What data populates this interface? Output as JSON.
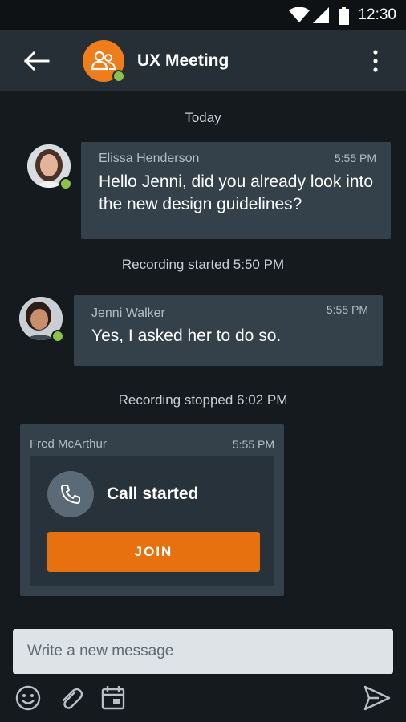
{
  "status_bar": {
    "time": "12:30"
  },
  "header": {
    "title": "UX Meeting"
  },
  "conversation": {
    "date_separator": "Today",
    "messages": [
      {
        "sender": "Elissa Henderson",
        "time": "5:55 PM",
        "text": "Hello Jenni, did you already look into the new design guidelines?"
      },
      {
        "sender": "Jenni Walker",
        "time": "5:55 PM",
        "text": "Yes, I asked her to do so."
      }
    ],
    "system_messages": [
      "Recording started 5:50 PM",
      "Recording stopped 6:02 PM"
    ],
    "call_card": {
      "sender": "Fred McArthur",
      "time": "5:55 PM",
      "status": "Call started",
      "button_label": "JOIN"
    }
  },
  "composer": {
    "placeholder": "Write a new message"
  },
  "colors": {
    "accent": "#e8710f",
    "online": "#8bc34a",
    "bubble": "#34414b",
    "background": "#151a1e"
  },
  "icons": [
    "back-arrow-icon",
    "group-icon",
    "more-vert-icon",
    "phone-icon",
    "emoji-icon",
    "attachment-icon",
    "calendar-icon",
    "send-icon"
  ]
}
